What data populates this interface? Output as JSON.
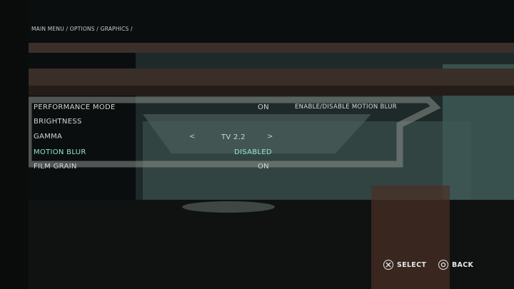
{
  "breadcrumb": "MAIN MENU / OPTIONS / GRAPHICS /",
  "settings": [
    {
      "label": "PERFORMANCE MODE",
      "value": "ON"
    },
    {
      "label": "BRIGHTNESS",
      "value": ""
    },
    {
      "label": "GAMMA",
      "value": "TV 2.2",
      "left_arrow": "<",
      "right_arrow": ">"
    },
    {
      "label": "MOTION BLUR",
      "value": "DISABLED"
    },
    {
      "label": "FILM GRAIN",
      "value": "ON"
    }
  ],
  "description": "ENABLE/DISABLE MOTION BLUR",
  "footer": {
    "select_label": "SELECT",
    "select_icon": "cross-icon",
    "back_label": "BACK",
    "back_icon": "circle-icon"
  },
  "colors": {
    "highlight": "#8fe3cf",
    "text": "#d3d6d4"
  }
}
